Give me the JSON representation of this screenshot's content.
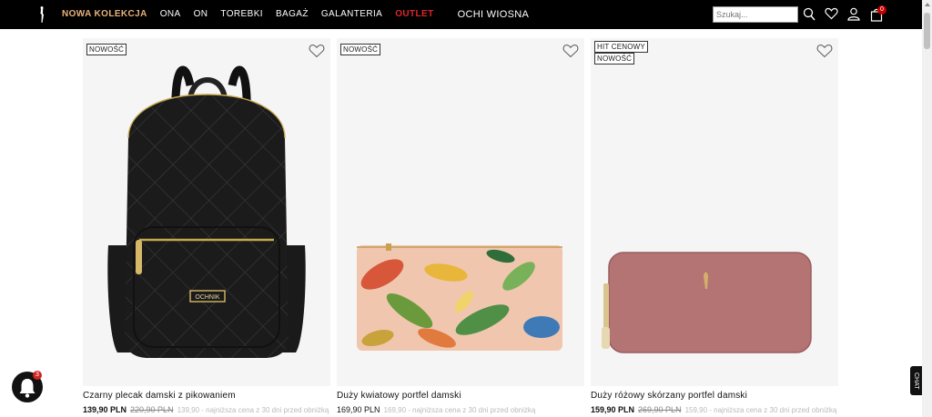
{
  "header": {
    "nav": [
      "NOWA KOLEKCJA",
      "ONA",
      "ON",
      "TOREBKI",
      "BAGAŻ",
      "GALANTERIA",
      "OUTLET",
      "OCHI WIOSNA"
    ],
    "search_placeholder": "Szukaj...",
    "cart_count": "0",
    "icons": [
      "logo-icon",
      "search-icon",
      "heart-icon",
      "user-icon",
      "cart-icon"
    ]
  },
  "products": [
    {
      "tags": [
        "NOWOŚĆ"
      ],
      "title": "Czarny plecak damski z pikowaniem",
      "price": "139,90 PLN",
      "old_price": "220,90 PLN",
      "lowest": "139,90 - najniższa cena z 30 dni przed obniżką",
      "brand_plate": "OCHNIK"
    },
    {
      "tags": [
        "NOWOŚĆ"
      ],
      "title": "Duży kwiatowy portfel damski",
      "price": "169,90 PLN",
      "old_price": "",
      "lowest": "169,90 - najniższa cena z 30 dni przed obniżką"
    },
    {
      "tags": [
        "HIT CENOWY",
        "NOWOŚĆ"
      ],
      "title": "Duży różowy skórzany portfel damski",
      "price": "159,90 PLN",
      "old_price": "269,90 PLN",
      "lowest": "159,90 - najniższa cena z 30 dni przed obniżką"
    }
  ],
  "notification_count": "3",
  "chat_label": "CHAT",
  "colors": {
    "topbar": "#000000",
    "accent": "#e8b27a",
    "outlet": "#e0242a",
    "badge": "#c40000"
  }
}
